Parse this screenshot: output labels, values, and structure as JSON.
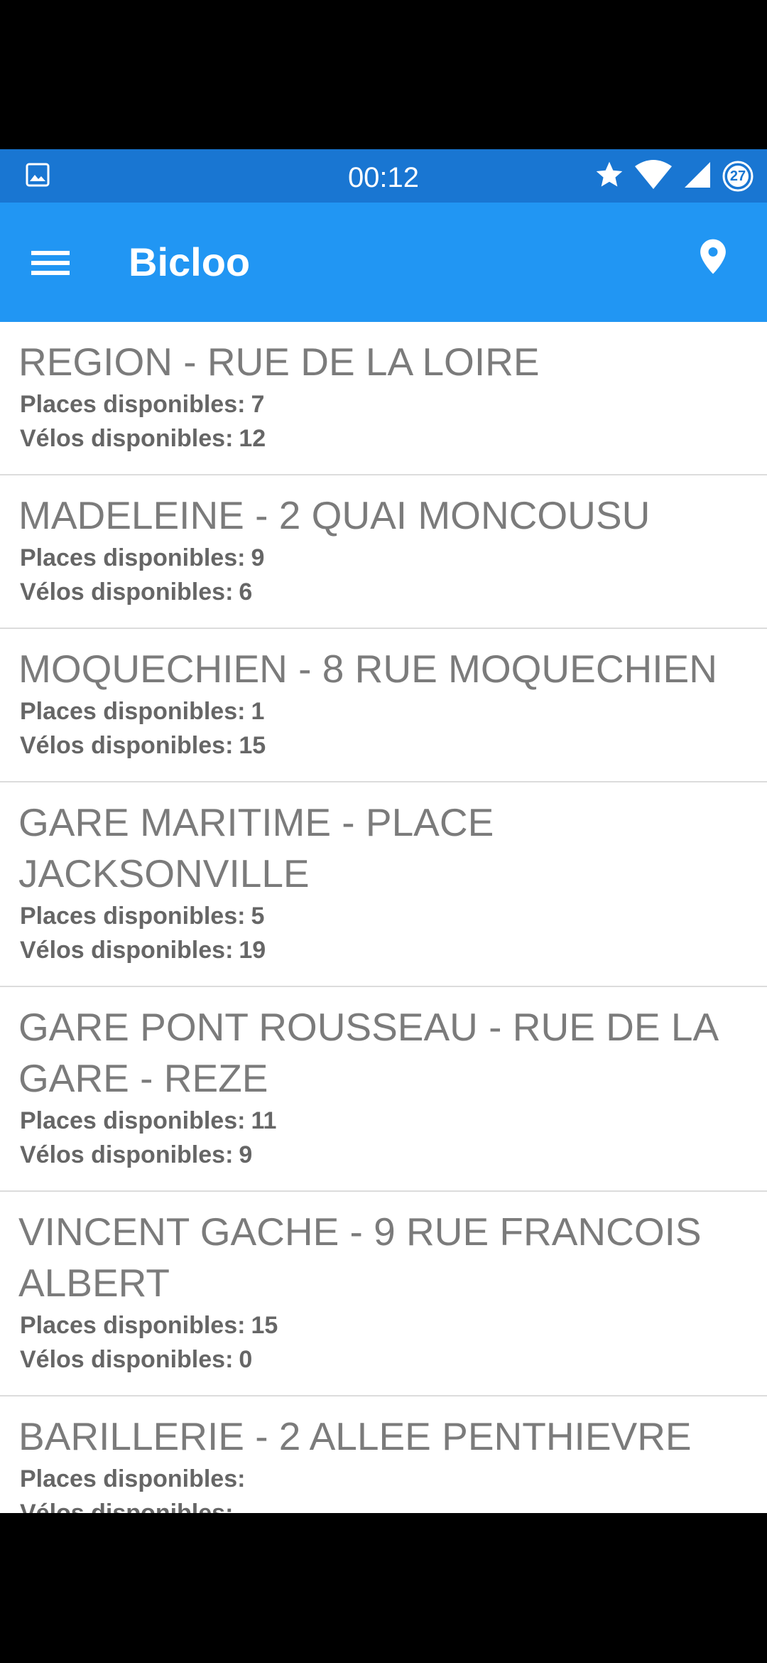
{
  "status_bar": {
    "time": "00:12",
    "notification_count": "27"
  },
  "app_bar": {
    "title": "Bicloo"
  },
  "stations": [
    {
      "name": "REGION - RUE DE LA LOIRE",
      "places_label": "Places disponibles:",
      "places": "7",
      "velos_label": "Vélos disponibles:",
      "velos": "12"
    },
    {
      "name": "MADELEINE - 2 QUAI MONCOUSU",
      "places_label": "Places disponibles:",
      "places": "9",
      "velos_label": "Vélos disponibles:",
      "velos": "6"
    },
    {
      "name": "MOQUECHIEN - 8 RUE MOQUECHIEN",
      "places_label": "Places disponibles:",
      "places": "1",
      "velos_label": "Vélos disponibles:",
      "velos": "15"
    },
    {
      "name": "GARE MARITIME - PLACE JACKSONVILLE",
      "places_label": "Places disponibles:",
      "places": "5",
      "velos_label": "Vélos disponibles:",
      "velos": "19"
    },
    {
      "name": "GARE PONT ROUSSEAU - RUE DE LA GARE - REZE",
      "places_label": "Places disponibles:",
      "places": "11",
      "velos_label": "Vélos disponibles:",
      "velos": "9"
    },
    {
      "name": "VINCENT GACHE - 9 RUE FRANCOIS ALBERT",
      "places_label": "Places disponibles:",
      "places": "15",
      "velos_label": "Vélos disponibles:",
      "velos": "0"
    },
    {
      "name": "BARILLERIE - 2 ALLEE PENTHIEVRE",
      "places_label": "Places disponibles:",
      "places": "",
      "velos_label": "Vélos disponibles:",
      "velos": ""
    }
  ],
  "icons": {
    "status_left": "image-icon",
    "status_star": "star-icon",
    "status_wifi": "wifi-icon",
    "status_signal": "signal-icon",
    "status_badge": "notification-badge-icon",
    "menu": "menu-icon",
    "location": "location-pin-icon"
  },
  "colors": {
    "status_bar": "#1976D2",
    "app_bar": "#2196F3",
    "list_bg": "#FFFFFF",
    "divider": "#DCDCDC",
    "station_name": "#7B7B7B",
    "station_detail": "#666666"
  }
}
